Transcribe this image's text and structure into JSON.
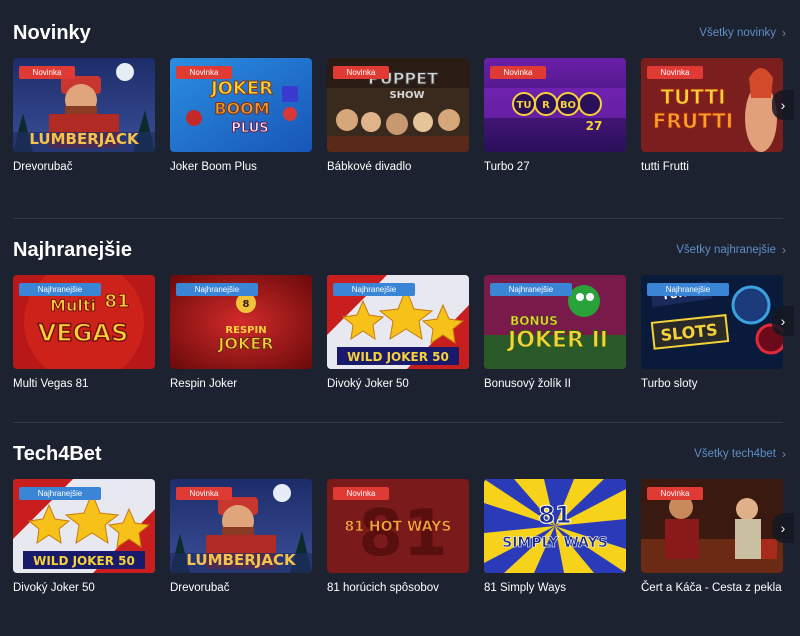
{
  "sections": [
    {
      "title": "Novinky",
      "see_all": "Všetky novinky",
      "games": [
        {
          "name": "Drevorubač",
          "badge": "Novinka",
          "art": "LUMBERJACK"
        },
        {
          "name": "Joker Boom Plus",
          "badge": "Novinka",
          "art": "JOKER BOOM PLUS"
        },
        {
          "name": "Bábkové divadlo",
          "badge": "Novinka",
          "art": "PUPPET SHOW"
        },
        {
          "name": "Turbo 27",
          "badge": "Novinka",
          "art": "TURBO 27"
        },
        {
          "name": "tutti Frutti",
          "badge": "Novinka",
          "art": "TUTTI FRUTTI"
        }
      ]
    },
    {
      "title": "Najhranejšie",
      "see_all": "Všetky najhranejšie",
      "games": [
        {
          "name": "Multi Vegas 81",
          "badge": "Najhranejšie",
          "art": "MULTI VEGAS 81"
        },
        {
          "name": "Respin Joker",
          "badge": "Najhranejšie",
          "art": "RESPIN JOKER"
        },
        {
          "name": "Divoký Joker 50",
          "badge": "Najhranejšie",
          "art": "WILD JOKER 50"
        },
        {
          "name": "Bonusový žolík II",
          "badge": "Najhranejšie",
          "art": "BONUS JOKER II"
        },
        {
          "name": "Turbo sloty",
          "badge": "Najhranejšie",
          "art": "TURBO SLOTS"
        }
      ]
    },
    {
      "title": "Tech4Bet",
      "see_all": "Všetky tech4bet",
      "games": [
        {
          "name": "Divoký Joker 50",
          "badge": "Najhranejšie",
          "art": "WILD JOKER 50"
        },
        {
          "name": "Drevorubač",
          "badge": "Novinka",
          "art": "LUMBERJACK"
        },
        {
          "name": "81 horúcich spôsobov",
          "badge": "Novinka",
          "art": "81 HOT WAYS"
        },
        {
          "name": "81 Simply Ways",
          "badge": "",
          "art": "81 SIMPLY WAYS"
        },
        {
          "name": "Čert a Káča - Cesta z pekla",
          "badge": "Novinka",
          "art": ""
        }
      ]
    }
  ],
  "icons": {
    "see_all": "chevron-right-icon",
    "scroll": "chevron-right-icon"
  },
  "colors": {
    "background": "#1c2230",
    "link": "#5f8ec7",
    "badge_new": "#e03a35",
    "badge_top": "#3a85d6"
  }
}
